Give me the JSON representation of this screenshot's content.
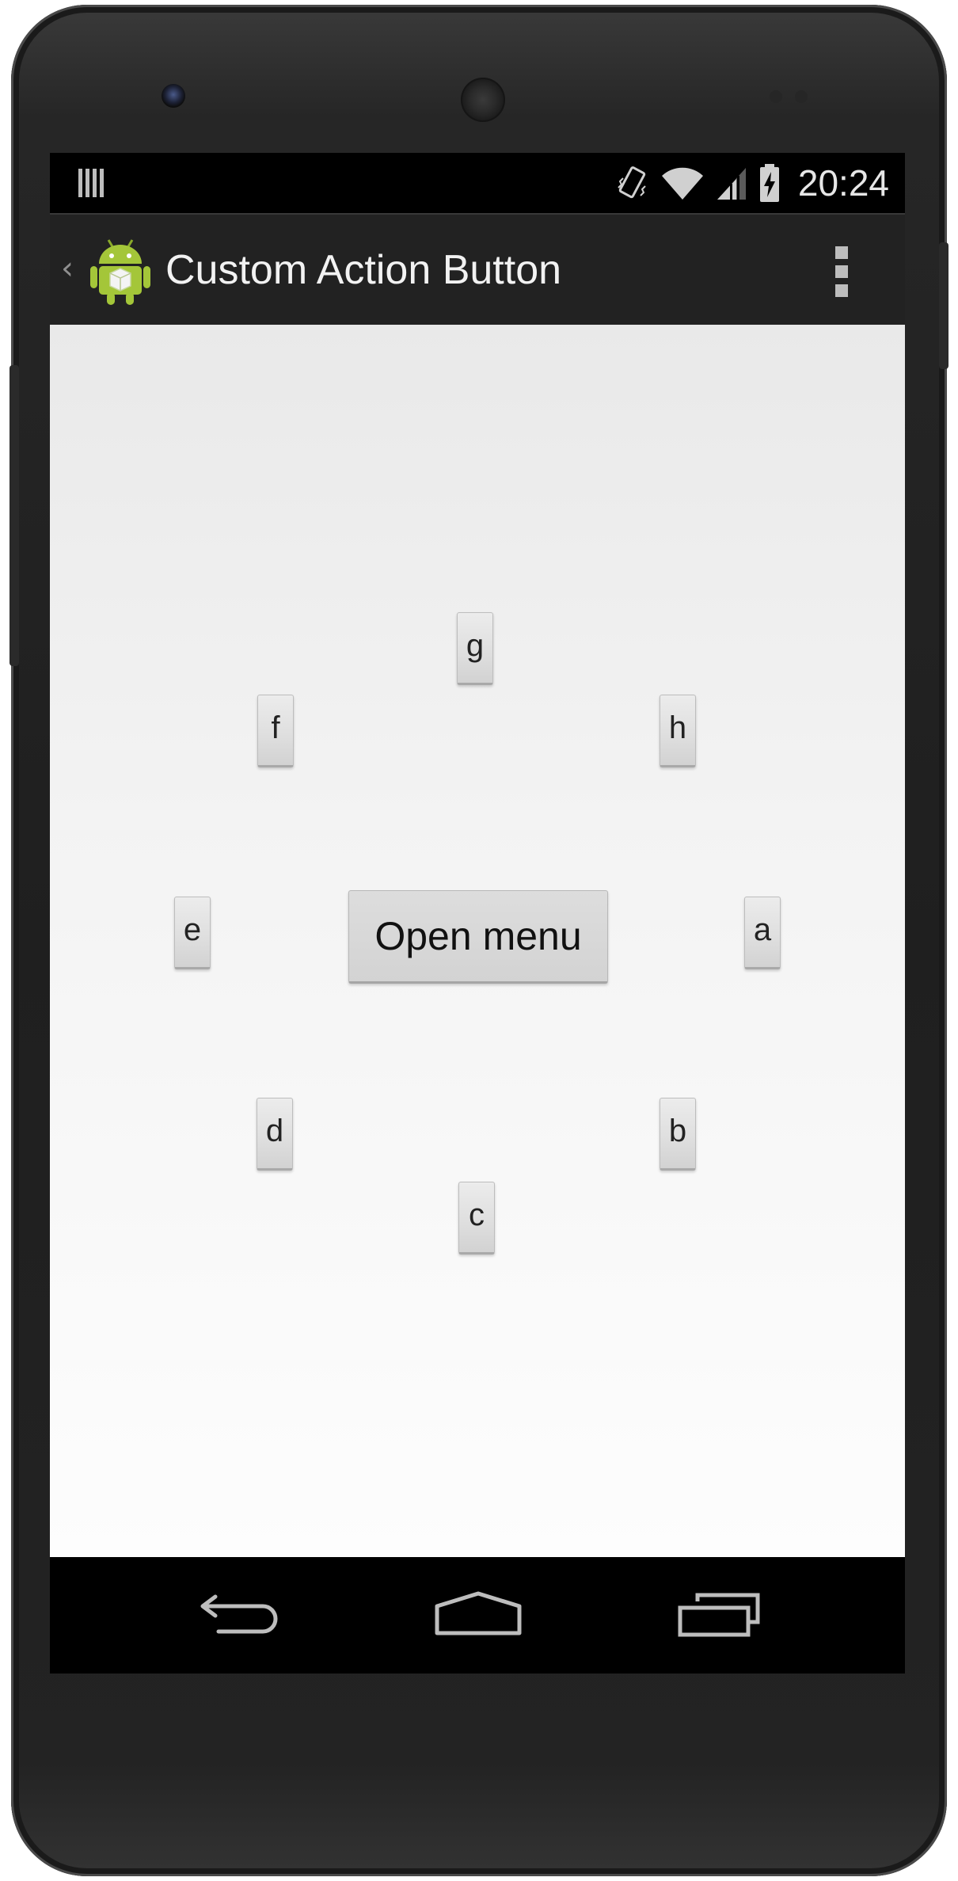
{
  "status_bar": {
    "time": "20:24",
    "icons": [
      "notification-icon",
      "vibrate-icon",
      "wifi-icon",
      "signal-icon",
      "battery-charging-icon"
    ]
  },
  "action_bar": {
    "title": "Custom Action Button",
    "icon": "android-app-icon",
    "overflow_icon": "overflow-menu-icon"
  },
  "main": {
    "open_menu_label": "Open menu",
    "menu_buttons": {
      "a": "a",
      "b": "b",
      "c": "c",
      "d": "d",
      "e": "e",
      "f": "f",
      "g": "g",
      "h": "h"
    }
  },
  "nav_bar": {
    "icons": [
      "back-icon",
      "home-icon",
      "recent-apps-icon"
    ]
  },
  "colors": {
    "status_bar_bg": "#000000",
    "action_bar_bg": "#222222",
    "content_bg": "#f2f2f2",
    "button_bg": "#d6d6d6",
    "android_green": "#a4c639"
  }
}
